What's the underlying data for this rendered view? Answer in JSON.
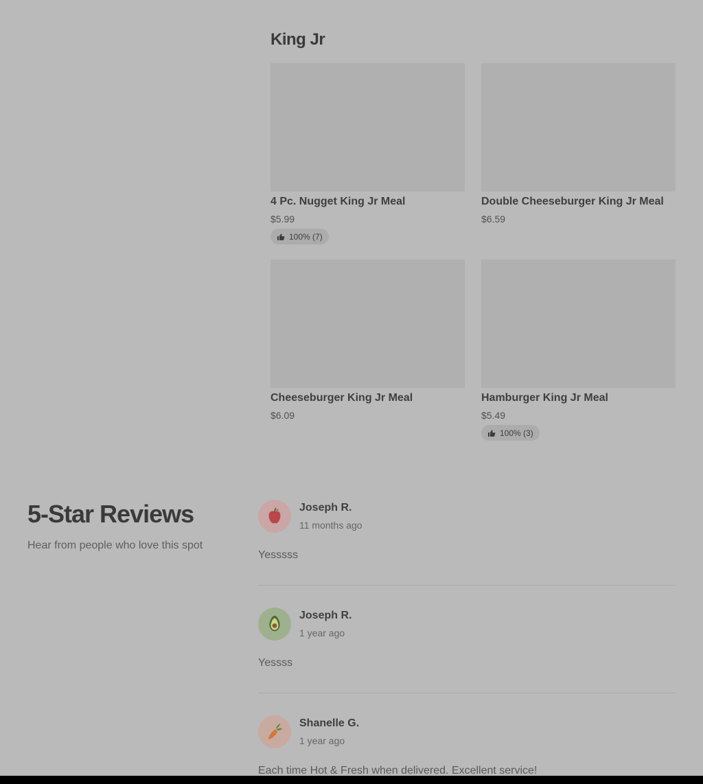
{
  "menu_section": {
    "title": "King Jr",
    "items": [
      {
        "name": "4 Pc. Nugget King Jr Meal",
        "price": "$5.99",
        "rating": "100% (7)"
      },
      {
        "name": "Double Cheeseburger King Jr Meal",
        "price": "$6.59",
        "rating": ""
      },
      {
        "name": "Cheeseburger King Jr Meal",
        "price": "$6.09",
        "rating": ""
      },
      {
        "name": "Hamburger King Jr Meal",
        "price": "$5.49",
        "rating": "100% (3)"
      }
    ]
  },
  "reviews": {
    "title": "5-Star Reviews",
    "subtitle": "Hear from people who love this spot",
    "items": [
      {
        "name": "Joseph R.",
        "time": "11 months ago",
        "text": "Yesssss",
        "avatar_icon": "apple-icon",
        "avatar_bg": "#caa6a6"
      },
      {
        "name": "Joseph R.",
        "time": "1 year ago",
        "text": "Yessss",
        "avatar_icon": "avocado-icon",
        "avatar_bg": "#9fb08e"
      },
      {
        "name": "Shanelle G.",
        "time": "1 year ago",
        "text": "Each time Hot & Fresh when delivered. Excellent service!",
        "avatar_icon": "carrot-icon",
        "avatar_bg": "#c9aaa0"
      }
    ]
  },
  "colors": {
    "background": "#bababa",
    "image_placeholder": "#b0b0b0",
    "badge": "#acacac"
  }
}
